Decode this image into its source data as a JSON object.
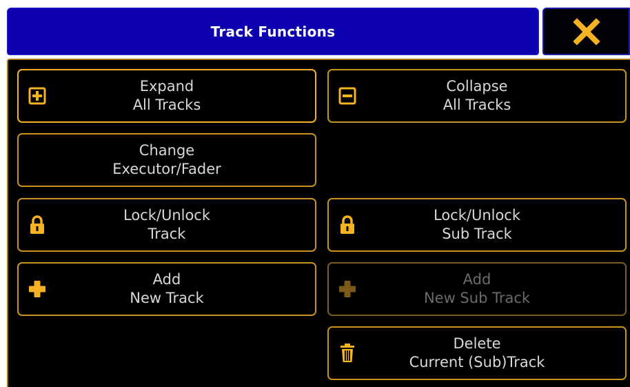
{
  "window": {
    "title": "Track Functions"
  },
  "buttons": {
    "expand_all": {
      "line1": "Expand",
      "line2": "All Tracks"
    },
    "collapse_all": {
      "line1": "Collapse",
      "line2": "All Tracks"
    },
    "change_executor": {
      "line1": "Change",
      "line2": "Executor/Fader"
    },
    "lock_track": {
      "line1": "Lock/Unlock",
      "line2": "Track"
    },
    "lock_sub_track": {
      "line1": "Lock/Unlock",
      "line2": "Sub Track"
    },
    "add_track": {
      "line1": "Add",
      "line2": "New Track"
    },
    "add_sub_track": {
      "line1": "Add",
      "line2": "New Sub Track",
      "state": "disabled"
    },
    "delete_track": {
      "line1": "Delete",
      "line2": "Current (Sub)Track"
    }
  },
  "icons": {
    "close": "close-icon",
    "expand": "plus-square-icon",
    "collapse": "minus-square-icon",
    "lock": "lock-icon",
    "add": "plus-icon",
    "delete": "trash-icon"
  },
  "colors": {
    "title_bar": "#0d00b0",
    "accent": "#f5b324",
    "button_border": "#c9941f",
    "text": "#d8d8d8",
    "disabled_text": "#6b6b6b"
  }
}
